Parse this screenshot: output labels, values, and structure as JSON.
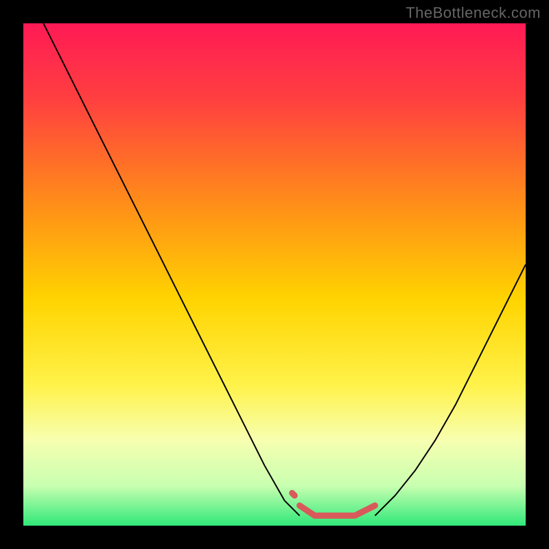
{
  "watermark": "TheBottleneck.com",
  "chart_data": {
    "type": "line",
    "title": "",
    "xlabel": "",
    "ylabel": "",
    "xlim": [
      0,
      100
    ],
    "ylim": [
      0,
      100
    ],
    "grid": false,
    "legend": false,
    "gradient_stops": [
      {
        "pct": 0,
        "color": "#ff1a55"
      },
      {
        "pct": 15,
        "color": "#ff3f40"
      },
      {
        "pct": 35,
        "color": "#ff8a1a"
      },
      {
        "pct": 55,
        "color": "#ffd400"
      },
      {
        "pct": 72,
        "color": "#fff24a"
      },
      {
        "pct": 83,
        "color": "#f7ffb0"
      },
      {
        "pct": 92,
        "color": "#c9ffb0"
      },
      {
        "pct": 100,
        "color": "#30e87a"
      }
    ],
    "series": [
      {
        "name": "curve-left",
        "stroke": "#000000",
        "stroke_width": 2,
        "x": [
          4,
          8,
          12,
          16,
          20,
          24,
          28,
          32,
          36,
          40,
          44,
          48,
          52,
          55
        ],
        "y": [
          100,
          92,
          84,
          76,
          68,
          60,
          52,
          44,
          36,
          28,
          20,
          12,
          5,
          2
        ]
      },
      {
        "name": "curve-right",
        "stroke": "#000000",
        "stroke_width": 2,
        "x": [
          70,
          74,
          78,
          82,
          86,
          90,
          94,
          98,
          100
        ],
        "y": [
          2,
          6,
          11,
          17,
          24,
          32,
          40,
          48,
          52
        ]
      },
      {
        "name": "highlight-band",
        "stroke": "#d85a5a",
        "stroke_width": 9,
        "caps": "round",
        "x": [
          55,
          58,
          62,
          66,
          70
        ],
        "y": [
          4,
          2,
          2,
          2,
          4
        ]
      },
      {
        "name": "highlight-dot",
        "stroke": "#d85a5a",
        "stroke_width": 9,
        "caps": "round",
        "x": [
          53.5,
          54
        ],
        "y": [
          6.5,
          6
        ]
      }
    ]
  }
}
